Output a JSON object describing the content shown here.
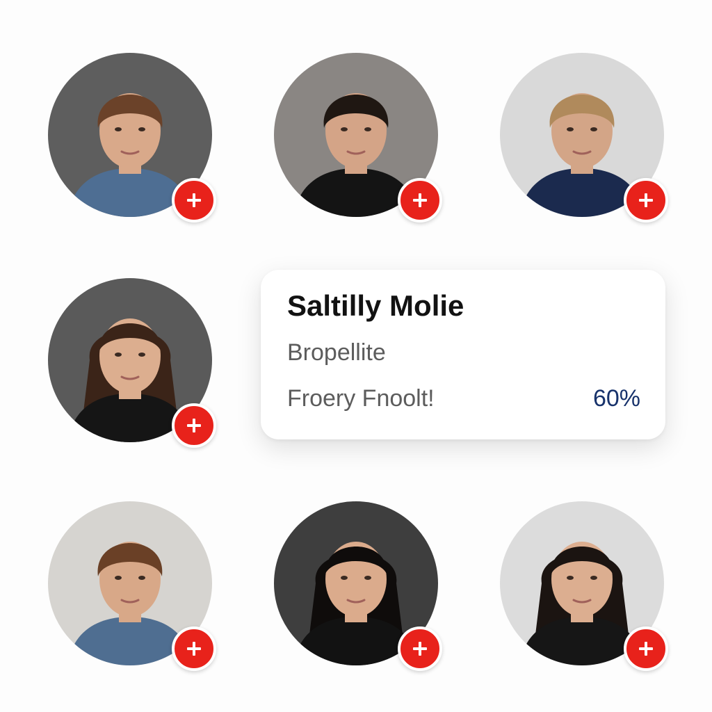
{
  "profile_card": {
    "name": "Saltilly Molie",
    "subtitle": "Bropellite",
    "status": "Froery Fnoolt!",
    "percent": "60%"
  },
  "avatars": [
    {
      "slot": "top-left",
      "bg": "#5e5e5e",
      "hair": "#6b4229",
      "skin": "#d9a98a",
      "clothes": "#4e6e93",
      "long_hair": false
    },
    {
      "slot": "top-center",
      "bg": "#8a8683",
      "hair": "#1f1712",
      "skin": "#d4a487",
      "clothes": "#141414",
      "long_hair": false
    },
    {
      "slot": "top-right",
      "bg": "#d9d9d9",
      "hair": "#b08a5c",
      "skin": "#d3a587",
      "clothes": "#1b2a4e",
      "long_hair": false
    },
    {
      "slot": "middle-left",
      "bg": "#5a5a5a",
      "hair": "#3b2418",
      "skin": "#dcae8f",
      "clothes": "#151515",
      "long_hair": true
    },
    {
      "slot": "bottom-left",
      "bg": "#d6d4d0",
      "hair": "#6a4026",
      "skin": "#d8a888",
      "clothes": "#4f6e91",
      "long_hair": false
    },
    {
      "slot": "bottom-center",
      "bg": "#3e3e3e",
      "hair": "#0f0c0b",
      "skin": "#dbab8c",
      "clothes": "#121212",
      "long_hair": true
    },
    {
      "slot": "bottom-right",
      "bg": "#dcdcdc",
      "hair": "#1b1411",
      "skin": "#dcae90",
      "clothes": "#161616",
      "long_hair": true
    }
  ],
  "add_button": {
    "icon": "plus-icon",
    "color": "#e8221b"
  }
}
